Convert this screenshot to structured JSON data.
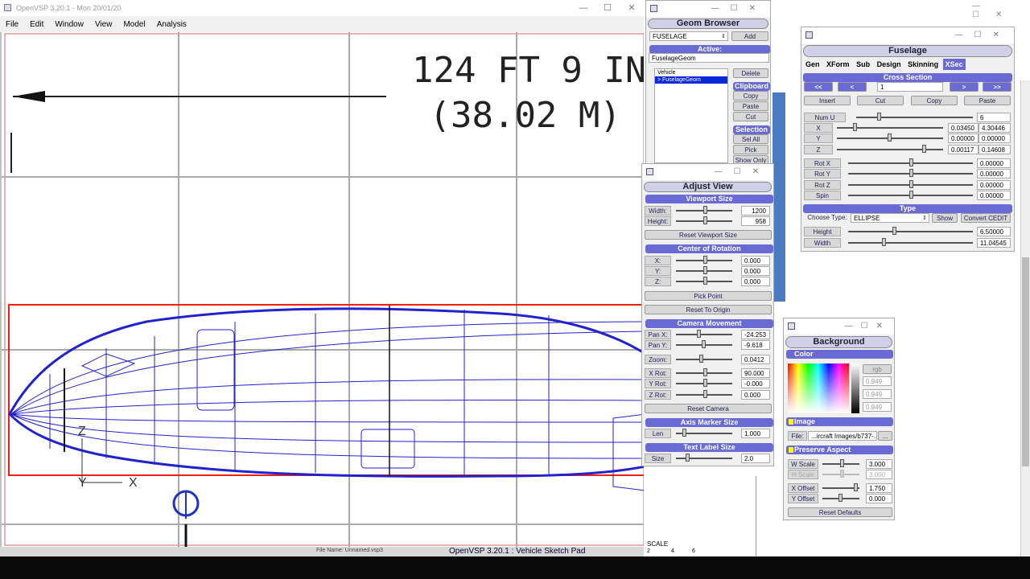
{
  "app": {
    "title": "OpenVSP 3.20.1 - Mon 20/01/20",
    "menu": [
      "File",
      "Edit",
      "Window",
      "View",
      "Model",
      "Analysis"
    ],
    "status_file": "File Name: Unnamed.vsp3",
    "status_title": "OpenVSP 3.20.1 : Vehicle Sketch Pad"
  },
  "canvas": {
    "dim_line1": "124 FT 9 IN",
    "dim_line2": "(38.02 M)",
    "axis_z": "Z",
    "axis_y": "Y",
    "axis_x": "X",
    "scale_label": "SCALE",
    "scale_ticks": [
      "2",
      "4",
      "6"
    ]
  },
  "geom_browser": {
    "title": "Geom Browser",
    "type_select": "FUSELAGE",
    "add": "Add",
    "active_label": "Active:",
    "active_value": "FuselageGeom",
    "tree": [
      "Vehicle",
      "> FuselageGeom"
    ],
    "delete": "Delete",
    "clipboard": "Clipboard",
    "copy": "Copy",
    "paste": "Paste",
    "cut": "Cut",
    "selection": "Selection",
    "sel_all": "Sel All",
    "pick": "Pick",
    "show_only": "Show Only"
  },
  "adjust_view": {
    "title": "Adjust View",
    "viewport_hdr": "Viewport Size",
    "width_lbl": "Width:",
    "width_val": "1200",
    "height_lbl": "Height:",
    "height_val": "958",
    "reset_viewport": "Reset Viewport Size",
    "cor_hdr": "Center of Rotation",
    "x_lbl": "X:",
    "x_val": "0.000",
    "y_lbl": "Y:",
    "y_val": "0.000",
    "z_lbl": "Z:",
    "z_val": "0.000",
    "pick_point": "Pick Point",
    "reset_origin": "Reset To Origin",
    "cam_hdr": "Camera Movement",
    "panx_lbl": "Pan X:",
    "panx_val": "-24.253",
    "pany_lbl": "Pan Y:",
    "pany_val": "-9.618",
    "zoom_lbl": "Zoom:",
    "zoom_val": "0.0412",
    "xrot_lbl": "X Rot:",
    "xrot_val": "90.000",
    "yrot_lbl": "Y Rot:",
    "yrot_val": "-0.000",
    "zrot_lbl": "Z Rot:",
    "zrot_val": "0.000",
    "reset_camera": "Reset Camera",
    "axis_hdr": "Axis Marker Size",
    "len_lbl": "Len",
    "len_val": "1.000",
    "text_hdr": "Text Label Size",
    "size_lbl": "Size",
    "size_val": "2.0"
  },
  "fuselage": {
    "title": "Fuselage",
    "tabs": [
      "Gen",
      "XForm",
      "Sub",
      "Design",
      "Skinning",
      "XSec"
    ],
    "cross_hdr": "Cross Section",
    "nav": [
      "<<",
      "<",
      "1",
      ">",
      ">>"
    ],
    "insert": "Insert",
    "cut": "Cut",
    "copy": "Copy",
    "paste": "Paste",
    "numu_lbl": "Num U",
    "numu_val": "6",
    "x_lbl": "X",
    "x_v1": "0.03450",
    "x_v2": "4.30446",
    "y_lbl": "Y",
    "y_v1": "0.00000",
    "y_v2": "0.00000",
    "z_lbl": "Z",
    "z_v1": "0.00117",
    "z_v2": "0.14608",
    "rotx_lbl": "Rot X",
    "rotx_val": "0.00000",
    "roty_lbl": "Rot Y",
    "roty_val": "0.00000",
    "rotz_lbl": "Rot Z",
    "rotz_val": "0.00000",
    "spin_lbl": "Spin",
    "spin_val": "0.00000",
    "type_hdr": "Type",
    "choose_type": "Choose Type:",
    "type_val": "ELLIPSE",
    "show": "Show",
    "convert": "Convert CEDIT",
    "height_lbl": "Height",
    "height_val": "6.50000",
    "width_lbl": "Width",
    "width_val": "11.04545"
  },
  "background": {
    "title": "Background",
    "color": "Color",
    "rgb": "rgb",
    "c1": "0.949",
    "c2": "0.949",
    "c3": "0.949",
    "image": "Image",
    "file_lbl": "File:",
    "file_val": "...ircraft Images/b737-...",
    "browse": "...",
    "preserve": "Preserve Aspect",
    "wscale_lbl": "W Scale",
    "wscale_val": "3.000",
    "hscale_lbl": "H Scale",
    "hscale_val": "3.000",
    "xoff_lbl": "X Offset",
    "xoff_val": "1.750",
    "yoff_lbl": "Y Offset",
    "yoff_val": "0.000",
    "reset": "Reset Defaults"
  }
}
